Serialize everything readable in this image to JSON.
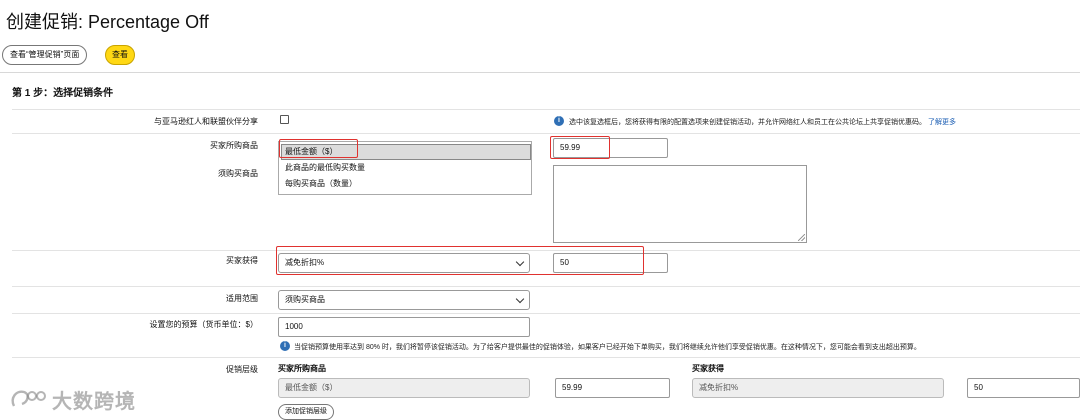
{
  "page": {
    "title": "创建促销: Percentage Off",
    "view_manage_button": "查看“管理促销”页面",
    "view_button": "查看"
  },
  "step": {
    "title": "第 1 步：选择促销条件"
  },
  "share": {
    "label": "与亚马逊红人和联盟伙伴分享",
    "checked": false,
    "info": "选中该复选框后，您将获得有限的配置选项来创建促销活动，并允许网络红人和员工在公共论坛上共享促销优惠码。",
    "learn_more": "了解更多"
  },
  "buyer_purchases": {
    "label": "买家所购商品",
    "options": [
      "最低金额（$）",
      "此商品的最低购买数量",
      "每购买商品（数量）"
    ],
    "selected_index": 0,
    "value": "59.99"
  },
  "required_items": {
    "label": "须购买商品",
    "value": ""
  },
  "buyer_gets": {
    "label": "买家获得",
    "selected": "减免折扣%",
    "value": "50"
  },
  "applies_to": {
    "label": "适用范围",
    "selected": "须购买商品"
  },
  "budget": {
    "label": "设置您的预算（货币单位：$）",
    "value": "1000",
    "info": "当促销预算使用率达到 80% 时，我们将暂停该促销活动。为了给客户提供最佳的促销体验，如果客户已经开始下单购买，我们将继续允许他们享受促销优惠。在这种情况下，您可能会看到支出超出预算。"
  },
  "tiers": {
    "label": "促销层级",
    "buyer_purchases_header": "买家所购商品",
    "buyer_gets_header": "买家获得",
    "purchase_type": "最低金额（$）",
    "purchase_value": "59.99",
    "gets_type": "减免折扣%",
    "gets_value": "50",
    "add_tier_button": "添加促销层级"
  },
  "watermark": {
    "text": "大数跨境"
  },
  "colors": {
    "accent_yellow": "#ffd814",
    "highlight_red": "#e0322f",
    "info_blue": "#2f6fb5",
    "link_blue": "#1a5db3"
  }
}
